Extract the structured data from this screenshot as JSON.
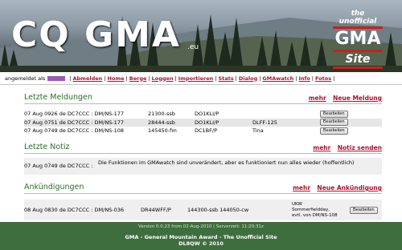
{
  "header": {
    "logo": "CQ GMA",
    "tld": ".eu",
    "badge_line1": "the unofficial",
    "badge_line2": "GMA",
    "badge_line3": "Site"
  },
  "nav": {
    "logged_in_label": "angemeldet als",
    "items": [
      "Abmelden",
      "Home",
      "Berge",
      "Loggen",
      "Importieren",
      "Stats",
      "Dialog",
      "GMAwatch",
      "Info",
      "Fotos"
    ]
  },
  "sections": {
    "meldungen": {
      "title": "Letzte Meldungen",
      "link_more": "mehr",
      "link_new": "Neue Meldung",
      "rows": [
        {
          "time": "07 Aug 0926 de DC7CCC : DM/NS-177",
          "qrg": "21300-ssb",
          "call": "DO1KLI/P",
          "extra": "",
          "button": "Bearbeiten"
        },
        {
          "time": "07 Aug 0751 de DC7CCC : DM/NS-177",
          "qrg": "28444-ssb",
          "call": "DO1KLI/P",
          "extra": "DLFF-125",
          "button": "Bearbeiten"
        },
        {
          "time": "07 Aug 0749 de DC7CCC : DM/NS-108",
          "qrg": "145450-fm",
          "call": "DC1BF/P",
          "extra": "Tina",
          "button": "Bearbeiten"
        }
      ]
    },
    "notiz": {
      "title": "Letzte Notiz",
      "link_more": "mehr",
      "link_send": "Notiz senden",
      "time": "07 Aug 0749 de DC7CCC :",
      "text": "Die Funktionen im GMAwatch sind unverändert, aber es funktioniert nun alles wieder (hoffentlich)"
    },
    "ankuendigungen": {
      "title": "Ankündigungen",
      "link_more": "mehr",
      "link_new": "Neue Ankündigung",
      "row": {
        "time": "08 Aug 0830 de DC7CCC : DM/NS-036",
        "ref": "DR44WFF/P",
        "qrg": "144300-ssb 144050-cw",
        "note1": "UKW",
        "note2": "Sommerfieldday,",
        "note3": "evtl. von DM/NS-108",
        "button": "Bearbeiten"
      }
    }
  },
  "footer": {
    "version": "Version 0.0.23 from 02-Aug-2010  |  Serverzeit: 11:20:31z",
    "line2": "GMA - General Mountain Award - The Unofficial Site",
    "line3": "DL8QW © 2010"
  }
}
